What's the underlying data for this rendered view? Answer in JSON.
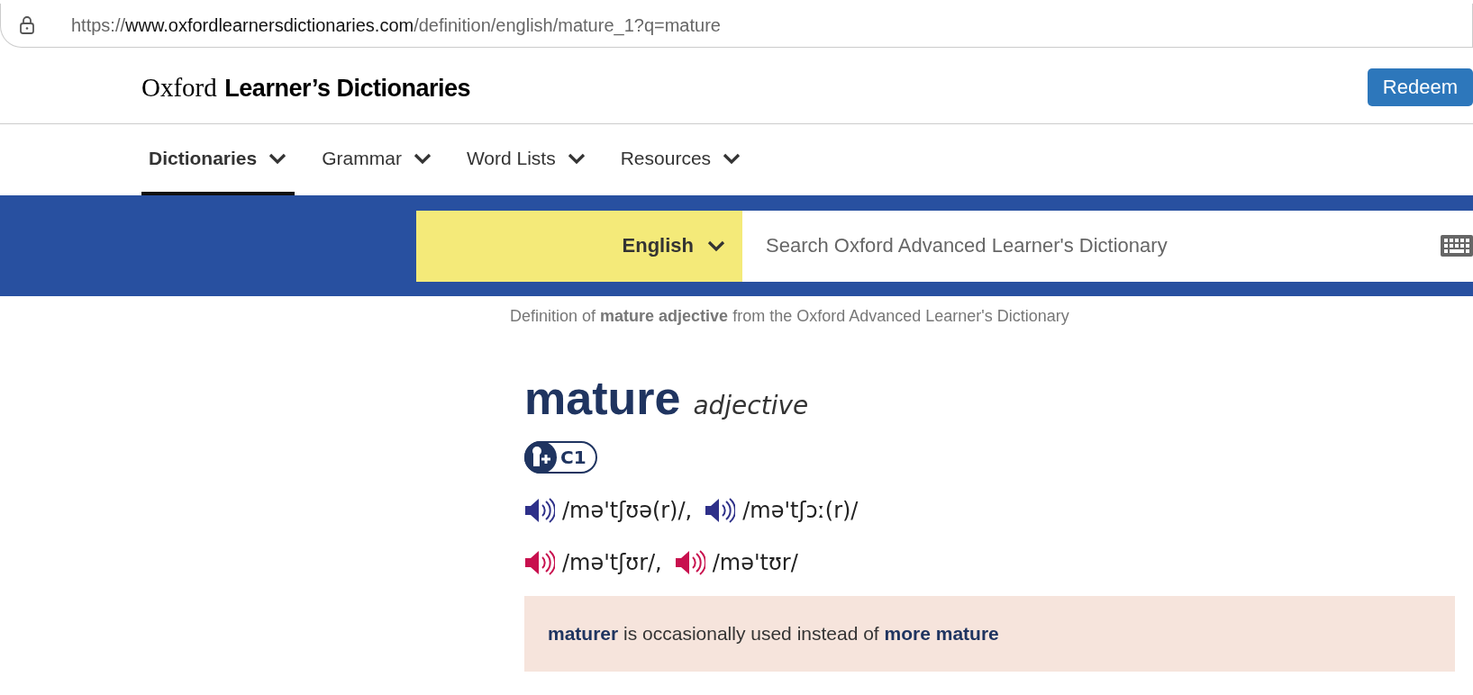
{
  "address_bar": {
    "url_start": "https://",
    "url_domain": "www.oxfordlearnersdictionaries.com",
    "url_path": "/definition/english/mature_1?q=mature"
  },
  "header": {
    "logo_serif": "Oxford",
    "logo_bold": "Learner’s Dictionaries",
    "button": "Redeem"
  },
  "nav": [
    {
      "label": "Dictionaries",
      "selected": true
    },
    {
      "label": "Grammar",
      "selected": false
    },
    {
      "label": "Word Lists",
      "selected": false
    },
    {
      "label": "Resources",
      "selected": false
    }
  ],
  "search": {
    "language": "English",
    "placeholder": "Search Oxford Advanced Learner's Dictionary"
  },
  "source_line": "Definition of **mature adjective** from the Oxford Advanced Learner's Dictionary",
  "entry": {
    "headword": "mature",
    "part_of_speech": "adjective",
    "level": "C1",
    "pronunciations": [
      {
        "kind": "british",
        "items": [
          "/mə'tʃʊə(r)/,",
          "/mə'tʃɔː(r)/"
        ]
      },
      {
        "kind": "american",
        "items": [
          "/mə'tʃʊr/,",
          "/mə'tʊr/"
        ]
      }
    ],
    "note": "**maturer** is occasionally used instead of **more mature**"
  }
}
